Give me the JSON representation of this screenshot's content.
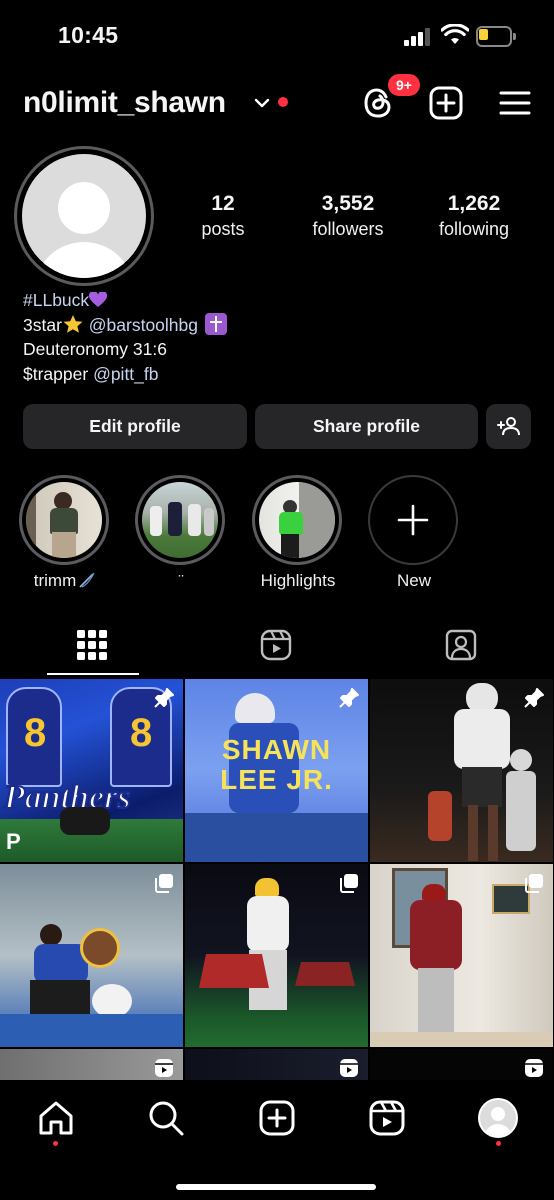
{
  "status_bar": {
    "time": "10:45",
    "battery_level": 0.2
  },
  "header": {
    "username": "n0limit_shawn",
    "notification_badge": "9+",
    "icons": [
      "threads-icon",
      "create-icon",
      "menu-icon"
    ]
  },
  "profile": {
    "stats": {
      "posts": {
        "value": "12",
        "label": "posts"
      },
      "followers": {
        "value": "3,552",
        "label": "followers"
      },
      "following": {
        "value": "1,262",
        "label": "following"
      }
    },
    "bio": {
      "line1_hashtag": "#LLbuck",
      "line2_text": "3star",
      "line2_mention": "@barstoolhbg",
      "line3": "Deuteronomy 31:6",
      "line4_text": "$trapper",
      "line4_mention": "@pitt_fb"
    }
  },
  "buttons": {
    "edit_profile": "Edit profile",
    "share_profile": "Share profile"
  },
  "highlights": [
    {
      "label": "trimm"
    },
    {
      "label": "̈"
    },
    {
      "label": "Highlights"
    },
    {
      "label": "New"
    }
  ],
  "grid": {
    "posts": [
      {
        "type": "pinned",
        "overlay_text": [
          "SHAWN",
          "LEE JR."
        ]
      },
      {
        "type": "pinned"
      },
      {
        "type": "pinned"
      },
      {
        "type": "carousel"
      },
      {
        "type": "carousel"
      },
      {
        "type": "carousel"
      },
      {
        "type": "reel"
      },
      {
        "type": "reel"
      },
      {
        "type": "reel"
      }
    ],
    "post2_text_line1": "SHAWN",
    "post2_text_line2": "LEE JR.",
    "post1_text": "Panthers"
  },
  "colors": {
    "background": "#000000",
    "button": "#262628",
    "accent_red": "#ff3040",
    "link": "#c7d4ee"
  }
}
